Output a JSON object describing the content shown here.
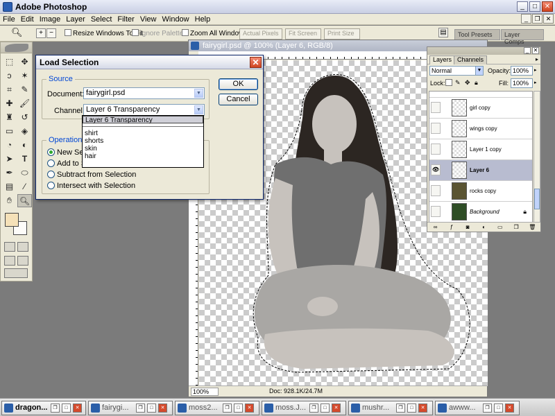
{
  "app": {
    "title": "Adobe Photoshop",
    "window_buttons": [
      "_",
      "□",
      "✕"
    ]
  },
  "menu": [
    "File",
    "Edit",
    "Image",
    "Layer",
    "Select",
    "Filter",
    "View",
    "Window",
    "Help"
  ],
  "options_bar": {
    "resize_windows_label": "Resize Windows To Fit",
    "ignore_palettes_label": "Ignore Palettes",
    "zoom_all_label": "Zoom All Windows",
    "actual_pixels": "Actual Pixels",
    "fit_screen": "Fit Screen",
    "print_size": "Print Size",
    "well_tab_1": "Tool Presets",
    "well_tab_2": "Layer Comps"
  },
  "document": {
    "title": "fairygirl.psd @ 100% (Layer 6, RGB/8)",
    "zoom": "100%",
    "doc_info": "Doc: 928.1K/24.7M"
  },
  "dialog": {
    "title": "Load Selection",
    "source_legend": "Source",
    "document_label": "Document:",
    "document_value": "fairygirl.psd",
    "channel_label": "Channel:",
    "channel_value": "Layer 6 Transparency",
    "ok": "OK",
    "cancel": "Cancel",
    "operation_legend": "Operation",
    "operations": [
      "New Selection",
      "Add to Selection",
      "Subtract from Selection",
      "Intersect with Selection"
    ],
    "operations_visible": [
      "New Selec",
      "Add to S",
      "Subtract from Selection",
      "Intersect with Selection"
    ],
    "channel_options_top": "Layer 6 Transparency",
    "channel_options": [
      "shirt",
      "shorts",
      "skin",
      "hair"
    ]
  },
  "layers_panel": {
    "tabs": [
      "Layers",
      "Channels"
    ],
    "blend_mode": "Normal",
    "opacity_label": "Opacity:",
    "opacity": "100%",
    "lock_label": "Lock:",
    "fill_label": "Fill:",
    "fill": "100%",
    "layers": [
      {
        "name": "girl copy",
        "selected": false
      },
      {
        "name": "wings copy",
        "selected": false
      },
      {
        "name": "Layer 1 copy",
        "selected": false
      },
      {
        "name": "Layer 6",
        "selected": true
      },
      {
        "name": "rocks copy",
        "selected": false
      },
      {
        "name": "Background",
        "selected": false
      }
    ]
  },
  "taskbar": [
    "dragon...",
    "fairygi...",
    "moss2...",
    "moss.J...",
    "mushr...",
    "awww..."
  ],
  "colors": {
    "foreground": "#f5e1b8",
    "background": "#fdfcf9",
    "selection_highlight": "#b8bcd0"
  },
  "icons": {
    "zoom_tool": "magnifier-icon",
    "eye": "eye-icon",
    "lock": "lock-icon"
  }
}
